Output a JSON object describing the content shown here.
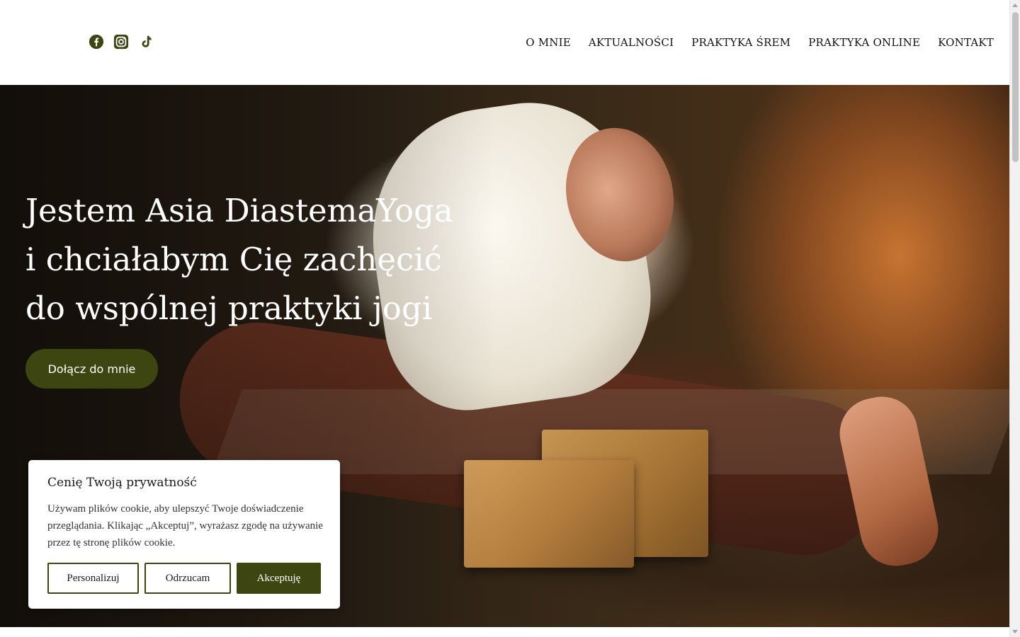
{
  "header": {
    "social": [
      {
        "icon": "facebook-icon"
      },
      {
        "icon": "instagram-icon"
      },
      {
        "icon": "tiktok-icon"
      }
    ],
    "nav": [
      {
        "label": "O MNIE"
      },
      {
        "label": "AKTUALNOŚCI"
      },
      {
        "label": "PRAKTYKA ŚREM"
      },
      {
        "label": "PRAKTYKA ONLINE"
      },
      {
        "label": "KONTAKT"
      }
    ]
  },
  "hero": {
    "title_lines": [
      "Jestem Asia DiastemaYoga",
      "i chciałabym Cię zachęcić",
      "do wspólnej praktyki jogi"
    ],
    "cta_label": "Dołącz do mnie"
  },
  "cookie": {
    "title": "Cenię Twoją prywatność",
    "text": "Używam plików cookie, aby ulepszyć Twoje doświadczenie przeglądania. Klikając „Akceptuj”, wyrażasz zgodę na używanie przez tę stronę plików cookie.",
    "personalize_label": "Personalizuj",
    "reject_label": "Odrzucam",
    "accept_label": "Akceptuję"
  },
  "colors": {
    "accent": "#3d4511",
    "icon": "#3d4511",
    "text_dark": "#111111",
    "hero_text": "#ffffff"
  }
}
